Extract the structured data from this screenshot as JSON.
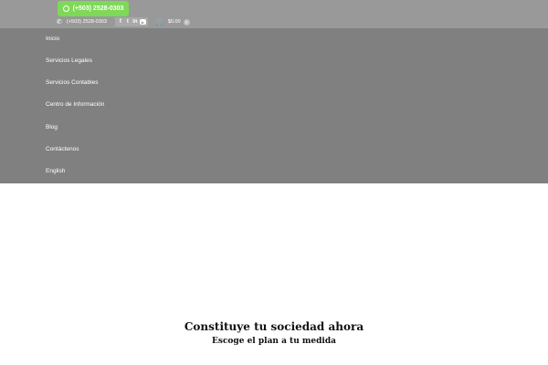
{
  "header": {
    "whatsapp_label": "(+503) 2528-0303",
    "phone_text": "(+503) 2528-0303",
    "social_icons": [
      {
        "name": "facebook-icon",
        "glyph": "f"
      },
      {
        "name": "twitter-icon",
        "glyph": "t"
      },
      {
        "name": "linkedin-icon",
        "glyph": "in"
      },
      {
        "name": "youtube-icon",
        "glyph": "▶"
      }
    ],
    "cart_total": "$0.00",
    "cart_count": "0"
  },
  "nav": {
    "items": [
      {
        "label": "Inicio"
      },
      {
        "label": "Servicios Legales"
      },
      {
        "label": "Servicios Contables"
      },
      {
        "label": "Centro de Información"
      },
      {
        "label": "Blog"
      },
      {
        "label": "Contáctenos"
      },
      {
        "label": "English"
      }
    ]
  },
  "hero": {
    "title": "Constituye tu sociedad ahora",
    "subtitle": "Escoge el plan a tu medida"
  },
  "colors": {
    "topbar": "#999999",
    "nav_panel": "#808080",
    "whatsapp_accent": "#7ed957",
    "page_background": "#ffffff"
  }
}
